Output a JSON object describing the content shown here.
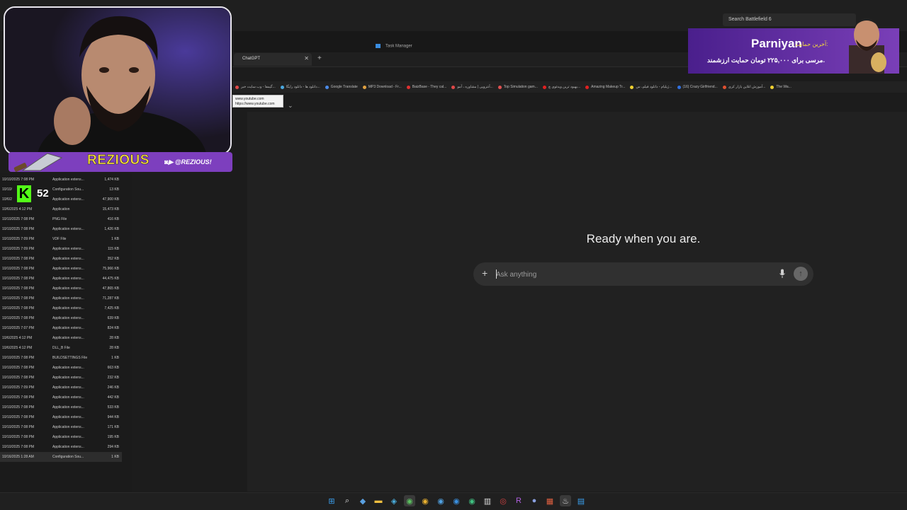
{
  "top": {
    "search_placeholder": "Search Battlefield 6",
    "task_manager": "Task Manager"
  },
  "browser": {
    "tab_title": "ChatGPT",
    "tab_close": "✕",
    "new_tab": "+",
    "bookmarks": [
      {
        "label": "گیمفا - وب سایت خبر...",
        "color": "#e04848"
      },
      {
        "label": "دانلود ها - دانلود رایگا...",
        "color": "#4aa8e0"
      },
      {
        "label": "Google Translate",
        "color": "#4a8ae8"
      },
      {
        "label": "MP3 Download - Fr...",
        "color": "#e0a040"
      },
      {
        "label": "BaizBase - They cal...",
        "color": "#e03030"
      },
      {
        "label": "آنتروپی | مشاوره ، آمو...",
        "color": "#e04848"
      },
      {
        "label": "Top Simulation gam...",
        "color": "#e05050"
      },
      {
        "label": "بهبود ترین ویدئوی چ...",
        "color": "#e02020"
      },
      {
        "label": "Amazing Makeup Tr...",
        "color": "#e02020"
      },
      {
        "label": "ژیلیام - دانلود فیلم، س...",
        "color": "#f0d030"
      },
      {
        "label": "(16) Crazy Girlfriend...",
        "color": "#3070e0"
      },
      {
        "label": "آموزش انلاین بازار کری...",
        "color": "#e05030"
      },
      {
        "label": "The Wa...",
        "color": "#f0d030"
      }
    ],
    "tooltip_line1": "www.youtube.com",
    "tooltip_line2": "https://www.youtube.com",
    "chevron": "⌄"
  },
  "chat": {
    "heading": "Ready when you are.",
    "placeholder": "Ask anything",
    "plus": "+",
    "send": "↑"
  },
  "files": [
    {
      "date": "10/10/2025 7:08 PM",
      "type": "Application extens...",
      "size": "1,474 KB"
    },
    {
      "date": "10/10/",
      "type": "Configuration Sou...",
      "size": "13 KB"
    },
    {
      "date": "10/6/2",
      "type": "Application extens...",
      "size": "47,900 KB"
    },
    {
      "date": "10/6/2025 4:12 PM",
      "type": "Application",
      "size": "15,473 KB"
    },
    {
      "date": "10/10/2025 7:08 PM",
      "type": "PNG File",
      "size": "416 KB"
    },
    {
      "date": "10/10/2025 7:08 PM",
      "type": "Application extens...",
      "size": "1,426 KB"
    },
    {
      "date": "10/10/2025 7:09 PM",
      "type": "VDF File",
      "size": "1 KB"
    },
    {
      "date": "10/10/2025 7:09 PM",
      "type": "Application extens...",
      "size": "115 KB"
    },
    {
      "date": "10/10/2025 7:08 PM",
      "type": "Application extens...",
      "size": "352 KB"
    },
    {
      "date": "10/10/2025 7:08 PM",
      "type": "Application extens...",
      "size": "75,966 KB"
    },
    {
      "date": "10/10/2025 7:08 PM",
      "type": "Application extens...",
      "size": "44,475 KB"
    },
    {
      "date": "10/10/2025 7:08 PM",
      "type": "Application extens...",
      "size": "47,865 KB"
    },
    {
      "date": "10/10/2025 7:08 PM",
      "type": "Application extens...",
      "size": "71,287 KB"
    },
    {
      "date": "10/10/2025 7:08 PM",
      "type": "Application extens...",
      "size": "7,425 KB"
    },
    {
      "date": "10/10/2025 7:08 PM",
      "type": "Application extens...",
      "size": "639 KB"
    },
    {
      "date": "10/10/2025 7:07 PM",
      "type": "Application extens...",
      "size": "824 KB"
    },
    {
      "date": "10/6/2025 4:12 PM",
      "type": "Application extens...",
      "size": "28 KB"
    },
    {
      "date": "10/6/2025 4:12 PM",
      "type": "DLL_B File",
      "size": "28 KB"
    },
    {
      "date": "10/10/2025 7:08 PM",
      "type": "BUILDSETTINGS File",
      "size": "1 KB"
    },
    {
      "date": "10/10/2025 7:08 PM",
      "type": "Application extens...",
      "size": "663 KB"
    },
    {
      "date": "10/10/2025 7:08 PM",
      "type": "Application extens...",
      "size": "232 KB"
    },
    {
      "date": "10/10/2025 7:09 PM",
      "type": "Application extens...",
      "size": "246 KB"
    },
    {
      "date": "10/10/2025 7:08 PM",
      "type": "Application extens...",
      "size": "442 KB"
    },
    {
      "date": "10/10/2025 7:08 PM",
      "type": "Application extens...",
      "size": "533 KB"
    },
    {
      "date": "10/10/2025 7:08 PM",
      "type": "Application extens...",
      "size": "944 KB"
    },
    {
      "date": "10/10/2025 7:08 PM",
      "type": "Application extens...",
      "size": "171 KB"
    },
    {
      "date": "10/10/2025 7:08 PM",
      "type": "Application extens...",
      "size": "195 KB"
    },
    {
      "date": "10/10/2025 7:08 PM",
      "type": "Application extens...",
      "size": "294 KB"
    },
    {
      "date": "10/16/2025 1:28 AM",
      "type": "Configuration Sou...",
      "size": "1 KB",
      "selected": true
    }
  ],
  "stream": {
    "name": "REZIOUS",
    "handle": "@REZIOUS!",
    "kick_letter": "K",
    "kick_count": "52",
    "sponsor_pre": "آخرین حمایت:",
    "sponsor_name": "Parniyan",
    "sponsor_line2": "مرسی برای ۲۲۵,۰۰۰ تومان حمایت ارزشمند."
  },
  "taskbar": [
    {
      "icon": "windows-start-icon",
      "glyph": "⊞",
      "color": "#3aa0f0"
    },
    {
      "icon": "search-icon",
      "glyph": "⌕",
      "color": "#ddd"
    },
    {
      "icon": "app-icon",
      "glyph": "◆",
      "color": "#5aa0e0"
    },
    {
      "icon": "file-explorer-icon",
      "glyph": "▬",
      "color": "#f0c040"
    },
    {
      "icon": "steam-app-icon",
      "glyph": "◈",
      "color": "#4ab0e0"
    },
    {
      "icon": "chrome-icon",
      "glyph": "◉",
      "color": "#5cc060",
      "active": true
    },
    {
      "icon": "chrome-canary-icon",
      "glyph": "◉",
      "color": "#e8b030"
    },
    {
      "icon": "chrome-dev-icon",
      "glyph": "◉",
      "color": "#50a0e0"
    },
    {
      "icon": "edge-icon",
      "glyph": "◉",
      "color": "#3a90e0"
    },
    {
      "icon": "edge-dev-icon",
      "glyph": "◉",
      "color": "#40c080"
    },
    {
      "icon": "taskmgr-icon",
      "glyph": "▥",
      "color": "#ddd"
    },
    {
      "icon": "davinci-icon",
      "glyph": "◎",
      "color": "#d04040"
    },
    {
      "icon": "rockstar-icon",
      "glyph": "R",
      "color": "#b060e0"
    },
    {
      "icon": "obs-icon",
      "glyph": "●",
      "color": "#8aa0e0"
    },
    {
      "icon": "app-red-icon",
      "glyph": "▦",
      "color": "#e06040"
    },
    {
      "icon": "steam-icon",
      "glyph": "♨",
      "color": "#ddd",
      "active": true
    },
    {
      "icon": "store-icon",
      "glyph": "▤",
      "color": "#3aa0f0"
    }
  ]
}
